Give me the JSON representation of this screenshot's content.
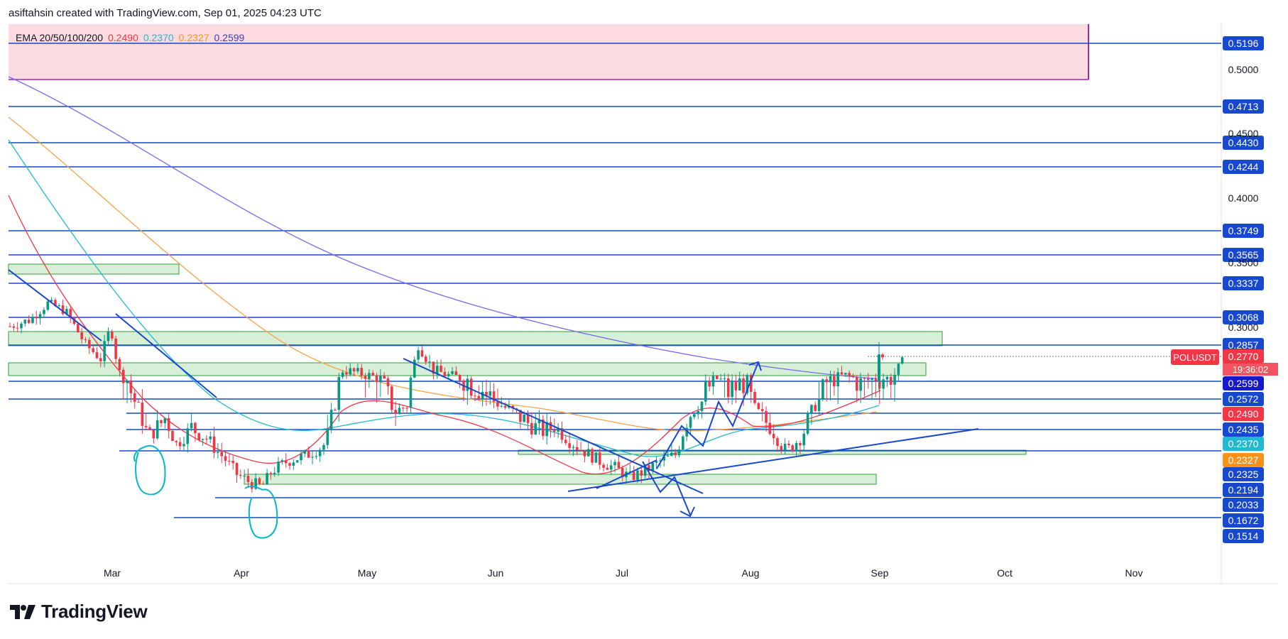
{
  "header": {
    "credit": "asiftahsin created with TradingView.com, Sep 01, 2025 04:23 UTC"
  },
  "brand": {
    "name": "TradingView"
  },
  "chart_data": {
    "type": "candlestick",
    "symbol": "POLUSDT",
    "last_price": "0.2770",
    "countdown": "19:36:02",
    "ema_legend": {
      "label": "EMA 20/50/100/200",
      "values": [
        {
          "period": 20,
          "value": "0.2490",
          "color": "#f23645"
        },
        {
          "period": 50,
          "value": "0.2370",
          "color": "#22b8cf"
        },
        {
          "period": 100,
          "value": "0.2327",
          "color": "#f7931a"
        },
        {
          "period": 200,
          "value": "0.2599",
          "color": "#3d3db8"
        }
      ]
    },
    "y_axis": {
      "ticks": [
        "0.5000",
        "0.4500",
        "0.4000",
        "0.3500",
        "0.3000"
      ],
      "price_labels": [
        {
          "text": "0.5196",
          "style": "blue"
        },
        {
          "text": "0.4713",
          "style": "blue"
        },
        {
          "text": "0.4430",
          "style": "blue"
        },
        {
          "text": "0.4244",
          "style": "blue"
        },
        {
          "text": "0.3749",
          "style": "blue"
        },
        {
          "text": "0.3565",
          "style": "blue"
        },
        {
          "text": "0.3337",
          "style": "blue"
        },
        {
          "text": "0.3068",
          "style": "blue"
        },
        {
          "text": "0.2857",
          "style": "blue"
        },
        {
          "text": "0.2770",
          "style": "last"
        },
        {
          "text": "0.2599",
          "style": "ema200"
        },
        {
          "text": "0.2572",
          "style": "blue"
        },
        {
          "text": "0.2490",
          "style": "ema20"
        },
        {
          "text": "0.2435",
          "style": "blue"
        },
        {
          "text": "0.2370",
          "style": "ema50"
        },
        {
          "text": "0.2327",
          "style": "ema100"
        },
        {
          "text": "0.2325",
          "style": "blue"
        },
        {
          "text": "0.2194",
          "style": "blue"
        },
        {
          "text": "0.2033",
          "style": "blue"
        },
        {
          "text": "0.1672",
          "style": "blue"
        },
        {
          "text": "0.1514",
          "style": "blue"
        }
      ]
    },
    "x_axis": {
      "months": [
        "Mar",
        "Apr",
        "May",
        "Jun",
        "Jul",
        "Aug",
        "Sep",
        "Oct",
        "Nov"
      ]
    },
    "colors": {
      "up": "#089981",
      "down": "#f23645",
      "level_line": "#1848cc",
      "zone_green": "#d6efd6",
      "zone_red": "#fbd7db",
      "annotation": "#00b8c8"
    }
  }
}
